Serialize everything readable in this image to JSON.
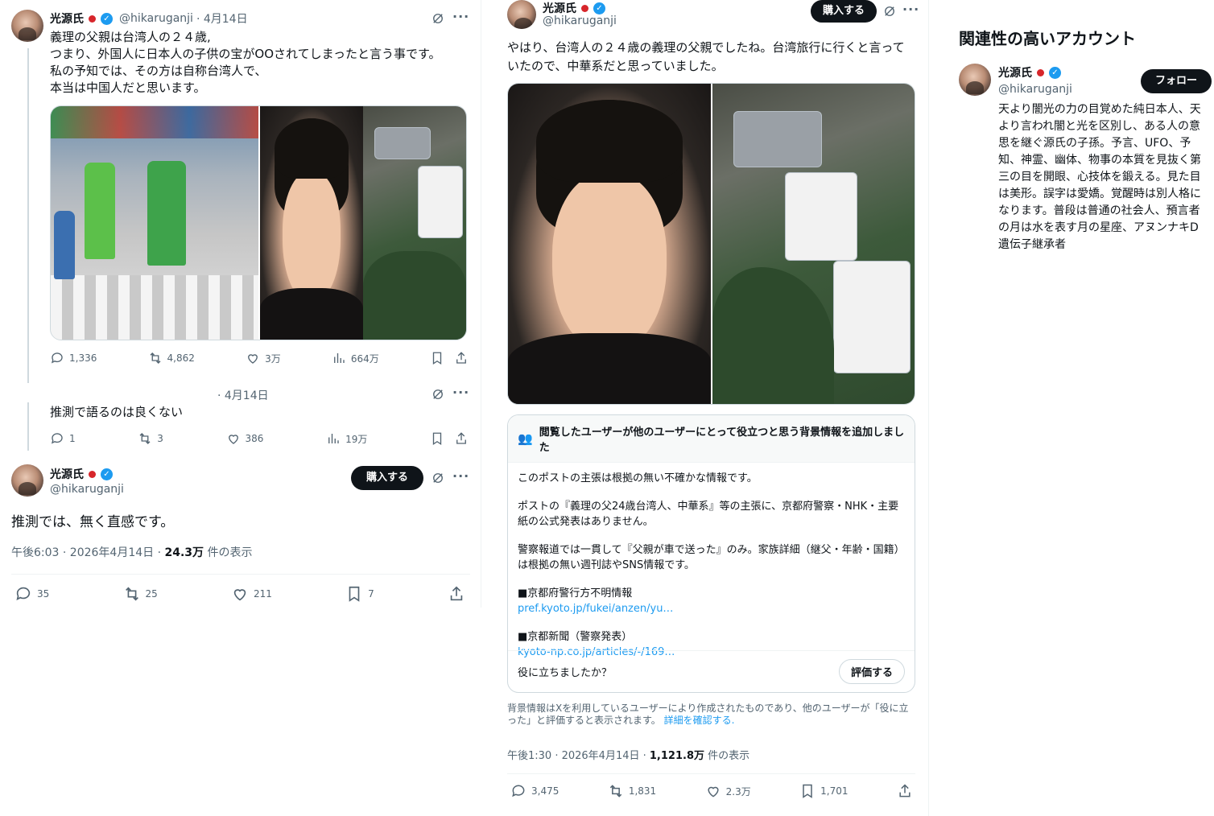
{
  "profile": {
    "name": "光源氏",
    "handle": "@hikaruganji"
  },
  "tweet1": {
    "date": "· 4月14日",
    "lines": [
      "義理の父親は台湾人の２４歳,",
      "つまり、外国人に日本人の子供の宝がOOされてしまったと言う事です。",
      "私の予知では、その方は自称台湾人で、",
      "本当は中国人だと思います。"
    ],
    "replies": "1,336",
    "retweets": "4,862",
    "likes": "3万",
    "views": "664万"
  },
  "tweet2": {
    "date": "· 4月14日",
    "text": "推測で語るのは良くない",
    "replies": "1",
    "retweets": "3",
    "likes": "386",
    "views": "19万"
  },
  "tweet3": {
    "buy_label": "購入する",
    "text": "推測では、無く直感です。",
    "meta_time": "午後6:03 · 2026年4月14日 · ",
    "meta_views": "24.3万",
    "meta_suffix": " 件の表示",
    "replies": "35",
    "retweets": "25",
    "likes": "211",
    "bookmarks": "7"
  },
  "tweet4": {
    "buy_label": "購入する",
    "lines": [
      "やはり、台湾人の２４歳の義理の父親でしたね。台湾旅行に行くと言って",
      "いたので、中華系だと思っていました。"
    ],
    "note": {
      "header": "閲覧したユーザーが他のユーザーにとって役立つと思う背景情報を追加しました",
      "p1": "このポストの主張は根拠の無い不確かな情報です。",
      "p2": "ポストの『義理の父24歳台湾人、中華系』等の主張に、京都府警察・NHK・主要紙の公式発表はありません。",
      "p3": "警察報道では一貫して『父親が車で送った』のみ。家族詳細（継父・年齢・国籍）は根拠の無い週刊誌やSNS情報です。",
      "s1_title": "■京都府警行方不明情報",
      "s1_link": "pref.kyoto.jp/fukei/anzen/yu…",
      "s2_title": "■京都新聞（警察発表）",
      "s2_link": "kyoto-np.co.jp/articles/-/169…",
      "helpful_q": "役に立ちましたか？",
      "rate_label": "評価する"
    },
    "disclaimer": "背景情報はXを利用しているユーザーにより作成されたものであり、他のユーザーが「役に立った」と評価すると表示されます。",
    "disclaimer_link": "詳細を確認する.",
    "meta_time": "午後1:30 · 2026年4月14日 · ",
    "meta_views": "1,121.8万",
    "meta_suffix": " 件の表示",
    "replies": "3,475",
    "retweets": "1,831",
    "likes": "2.3万",
    "bookmarks": "1,701"
  },
  "sidebar": {
    "title": "関連性の高いアカウント",
    "follow_label": "フォロー",
    "bio": "天より闇光の力の目覚めた純日本人、天より言われ闇と光を区別し、ある人の意思を継ぐ源氏の子孫。予言、UFO、予知、神霊、幽体、物事の本質を見抜く第三の目を開眼、心技体を鍛える。見た目は美形。誤字は愛嬌。覚醒時は別人格になります。普段は普通の社会人、預言者の月は水を表す月の星座、アヌンナキD遺伝子継承者"
  },
  "colors": {
    "accent": "#1d9bf0",
    "text": "#0f1419",
    "muted": "#536471",
    "flag": "#d7262b"
  }
}
